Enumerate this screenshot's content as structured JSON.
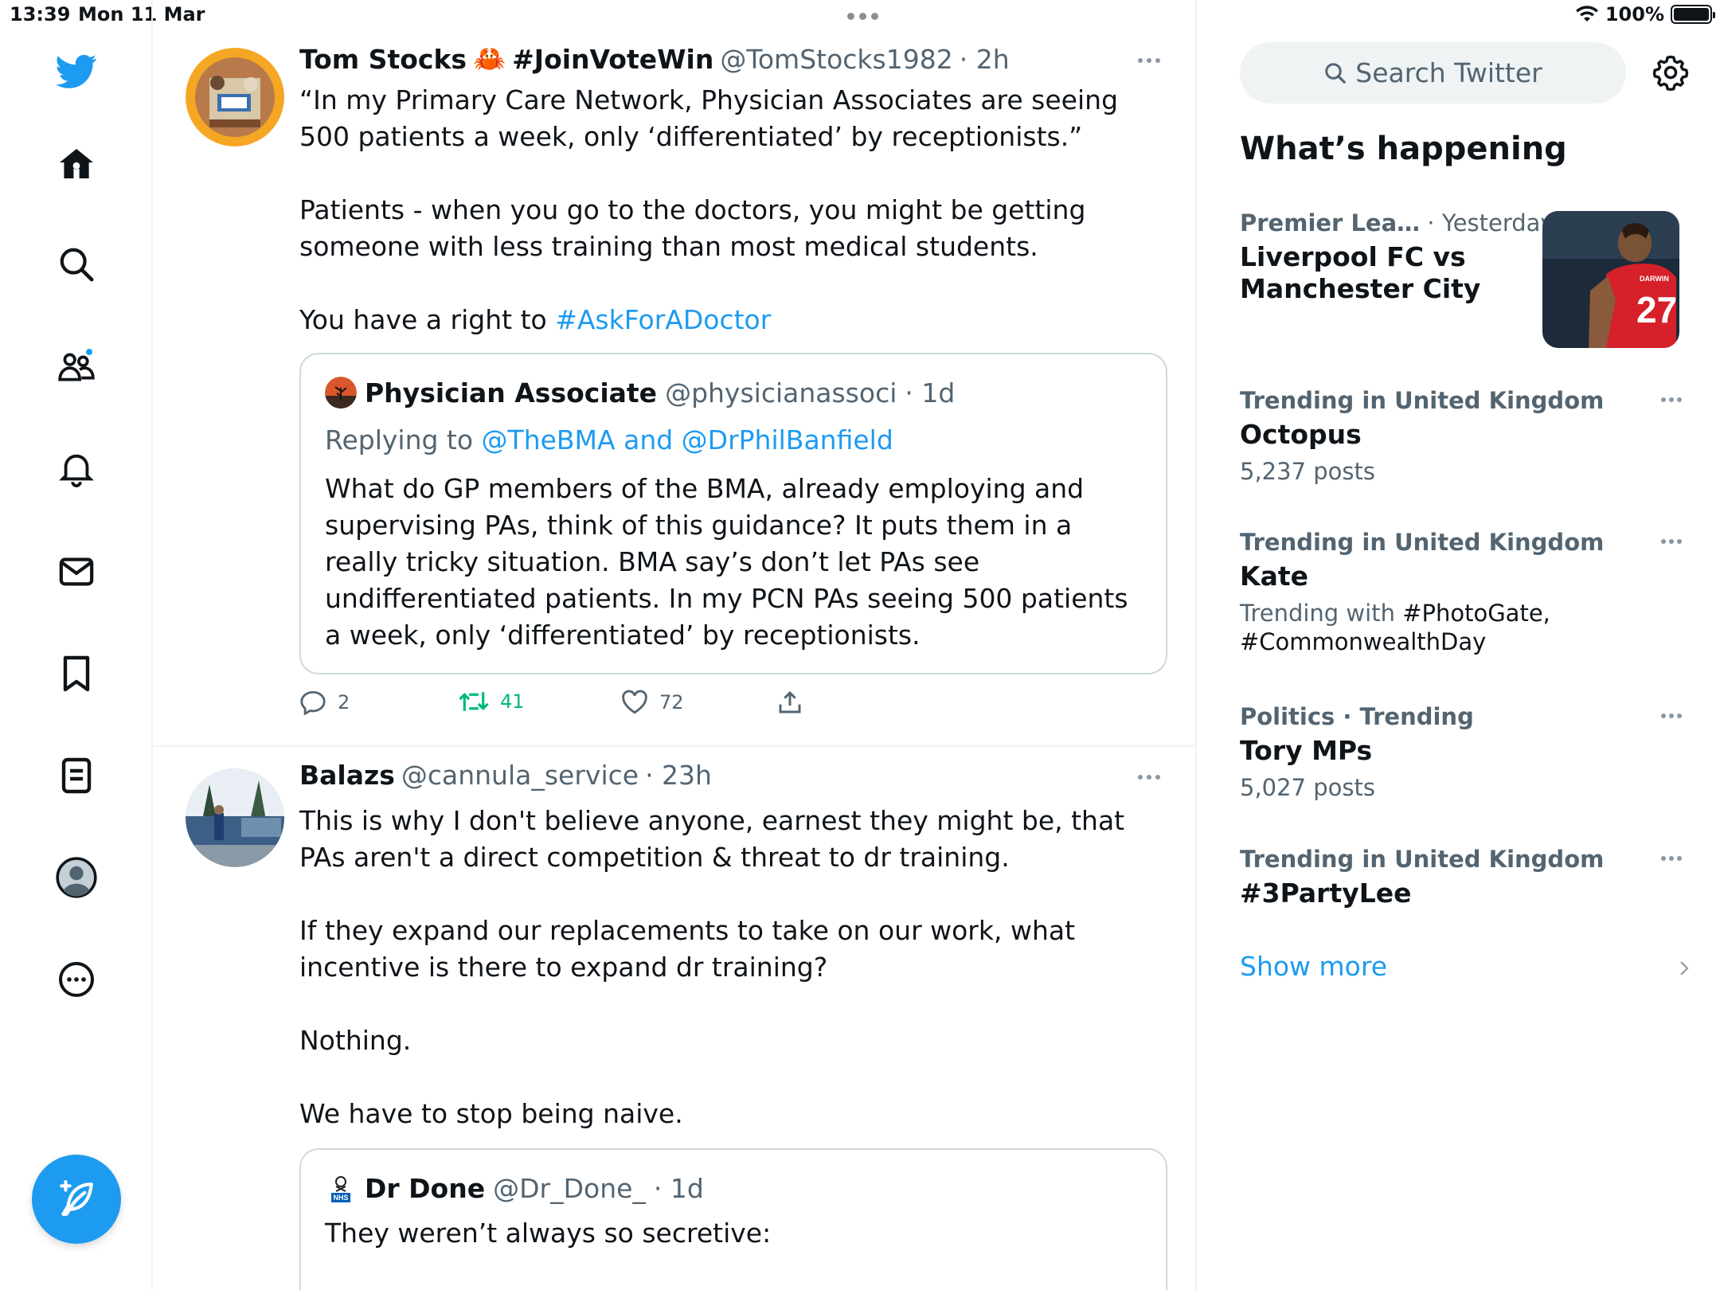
{
  "status_bar": {
    "time": "13:39",
    "date": "Mon 11 Mar",
    "battery": "100%"
  },
  "nav": {
    "items": [
      "twitter-logo",
      "home",
      "explore",
      "communities",
      "notifications",
      "messages",
      "bookmarks",
      "lists",
      "profile",
      "more"
    ],
    "compose_label": "Tweet"
  },
  "tweets": [
    {
      "name": "Tom Stocks",
      "emoji": "🦀",
      "hashtag_name": "#JoinVoteWin",
      "handle": "@TomStocks1982",
      "time": "· 2h",
      "p1": "“In my Primary Care Network, Physician Associates are seeing 500 patients a week, only ‘differentiated’ by receptionists.”",
      "p2": "Patients - when you go to the doctors, you might be getting someone with less training than most medical students.",
      "p3_prefix": "You have a right to ",
      "p3_link": "#AskForADoctor",
      "quote": {
        "name": "Physician Associate",
        "handle": "@physicianassoci",
        "time": "· 1d",
        "reply_prefix": "Replying to ",
        "reply_link": "@TheBMA and @DrPhilBanfield",
        "text": "What do GP members of the BMA, already employing and supervising PAs, think of this guidance? It puts them in a really tricky situation. BMA say’s don’t let PAs see undifferentiated patients. In my PCN PAs seeing 500 patients a week, only ‘differentiated’ by receptionists."
      },
      "replies": "2",
      "retweets": "41",
      "likes": "72"
    },
    {
      "name": "Balazs",
      "handle": "@cannula_service",
      "time": "· 23h",
      "p1": "This is why I don't believe anyone, earnest they might be, that PAs aren't a direct competition & threat to dr training.",
      "p2": "If they expand our replacements to take on our work, what incentive is there to expand dr training?",
      "p3": "Nothing.",
      "p4": "We have to stop being naive.",
      "quote": {
        "name": "Dr Done",
        "handle": "@Dr_Done_",
        "time": "· 1d",
        "text": "They weren’t always so secretive:"
      }
    }
  ],
  "sidebar": {
    "search_placeholder": "Search Twitter",
    "title": "What’s happening",
    "trends": [
      {
        "meta": "Premier Lea…",
        "meta2": "· Yesterday",
        "name": "Liverpool FC vs Manchester City",
        "sub": ""
      },
      {
        "meta": "Trending in United Kingdom",
        "name": "Octopus",
        "sub": "5,237 posts"
      },
      {
        "meta": "Trending in United Kingdom",
        "name": "Kate",
        "sub_prefix": "Trending with ",
        "sub_tags": "#PhotoGate, #CommonwealthDay"
      },
      {
        "meta": "Politics · Trending",
        "name": "Tory MPs",
        "sub": "5,027 posts"
      },
      {
        "meta": "Trending in United Kingdom",
        "name": "#3PartyLee",
        "sub": ""
      }
    ],
    "show_more": "Show more"
  }
}
